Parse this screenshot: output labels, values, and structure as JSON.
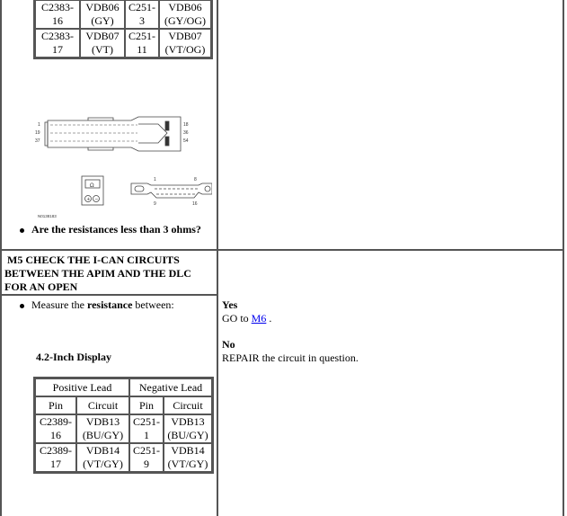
{
  "top_section": {
    "pin_table_rows": [
      {
        "pos_pin": [
          "C2383-",
          "16"
        ],
        "pos_circuit": [
          "VDB06",
          "(GY)"
        ],
        "neg_pin": [
          "C251-",
          "3"
        ],
        "neg_circuit": [
          "VDB06",
          "(GY/OG)"
        ]
      },
      {
        "pos_pin": [
          "C2383-",
          "17"
        ],
        "pos_circuit": [
          "VDB07",
          "(VT)"
        ],
        "neg_pin": [
          "C251-",
          "11"
        ],
        "neg_circuit": [
          "VDB07",
          "(VT/OG)"
        ]
      }
    ],
    "diagram": {
      "apim_connector_labels_left": [
        "1",
        "19",
        "37"
      ],
      "apim_connector_labels_right": [
        "18",
        "36",
        "54"
      ],
      "meter_symbol": "Ω",
      "meter_plus": "+",
      "meter_minus": "−",
      "dlc_labels_top": [
        "1",
        "8"
      ],
      "dlc_labels_bottom": [
        "9",
        "16"
      ],
      "figure_id": "N0138183"
    },
    "question": "Are the resistances less than 3 ohms?"
  },
  "step_m5": {
    "heading": "M5 CHECK THE I-CAN CIRCUITS BETWEEN THE APIM AND THE DLC FOR AN OPEN",
    "instruction_prefix": "Measure the ",
    "instruction_bold": "resistance",
    "instruction_suffix": " between:",
    "subheading": "4.2-Inch Display",
    "pin_table": {
      "group_headers": [
        "Positive Lead",
        "Negative Lead"
      ],
      "col_headers": [
        "Pin",
        "Circuit",
        "Pin",
        "Circuit"
      ],
      "rows": [
        {
          "pos_pin": [
            "C2389-",
            "16"
          ],
          "pos_circuit": [
            "VDB13",
            "(BU/GY)"
          ],
          "neg_pin": [
            "C251-",
            "1"
          ],
          "neg_circuit": [
            "VDB13",
            "(BU/GY)"
          ]
        },
        {
          "pos_pin": [
            "C2389-",
            "17"
          ],
          "pos_circuit": [
            "VDB14",
            "(VT/GY)"
          ],
          "neg_pin": [
            "C251-",
            "9"
          ],
          "neg_circuit": [
            "VDB14",
            "(VT/GY)"
          ]
        }
      ]
    },
    "answers": {
      "yes_label": "Yes",
      "yes_prefix": "GO to ",
      "yes_link": "M6",
      "yes_suffix": " .",
      "no_label": "No",
      "no_text": "REPAIR the circuit in question."
    }
  }
}
